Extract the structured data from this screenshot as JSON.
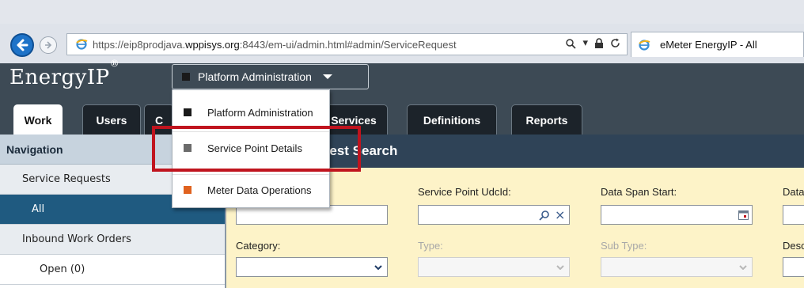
{
  "browser": {
    "url_prefix": "https://eip8prodjava.",
    "url_host": "wppisys.org",
    "url_suffix": ":8443/em-ui/admin.html#admin/ServiceRequest",
    "address_tools": "⌕ ▾ 🔒 C",
    "tab_title": "eMeter EnergyIP - All",
    "colors": {
      "back_button": "#1e73c8",
      "chrome": "#dfe3ea"
    }
  },
  "app": {
    "logo": "EnergyIP",
    "logo_mark": "®",
    "platform_dropdown": {
      "label": "Platform Administration",
      "square_color": "#1a1a1a"
    },
    "tabs": [
      {
        "label": "Work"
      },
      {
        "label": "Users"
      },
      {
        "label": "C"
      },
      {
        "label": "Services"
      },
      {
        "label": "Definitions"
      },
      {
        "label": "Reports"
      }
    ]
  },
  "dropdown_menu": {
    "items": [
      {
        "label": "Platform Administration",
        "color": "#1a1a1a"
      },
      {
        "label": "Service Point Details",
        "color": "#6b6b6b"
      },
      {
        "label": "Meter Data Operations",
        "color": "#e0621f"
      }
    ],
    "highlighted_item": "Service Point Details",
    "highlight_color": "#c0141e"
  },
  "navigation": {
    "header": "Navigation",
    "items": [
      {
        "label": "Service Requests",
        "kind": "group"
      },
      {
        "label": "All",
        "kind": "selected"
      },
      {
        "label": "Inbound Work Orders",
        "kind": "group"
      },
      {
        "label": "Open (0)",
        "kind": "sub"
      }
    ]
  },
  "main": {
    "title": "uest Search",
    "fields": [
      {
        "label": "Service Point UdcId:",
        "enabled": true
      },
      {
        "label": "Data Span Start:",
        "enabled": true
      },
      {
        "label": "Data",
        "enabled": true
      },
      {
        "label": "Category:",
        "enabled": true
      },
      {
        "label": "Type:",
        "enabled": false
      },
      {
        "label": "Sub Type:",
        "enabled": false
      },
      {
        "label": "Desc",
        "enabled": true
      }
    ],
    "icons": {
      "search": "⌕",
      "clear": "×"
    }
  }
}
